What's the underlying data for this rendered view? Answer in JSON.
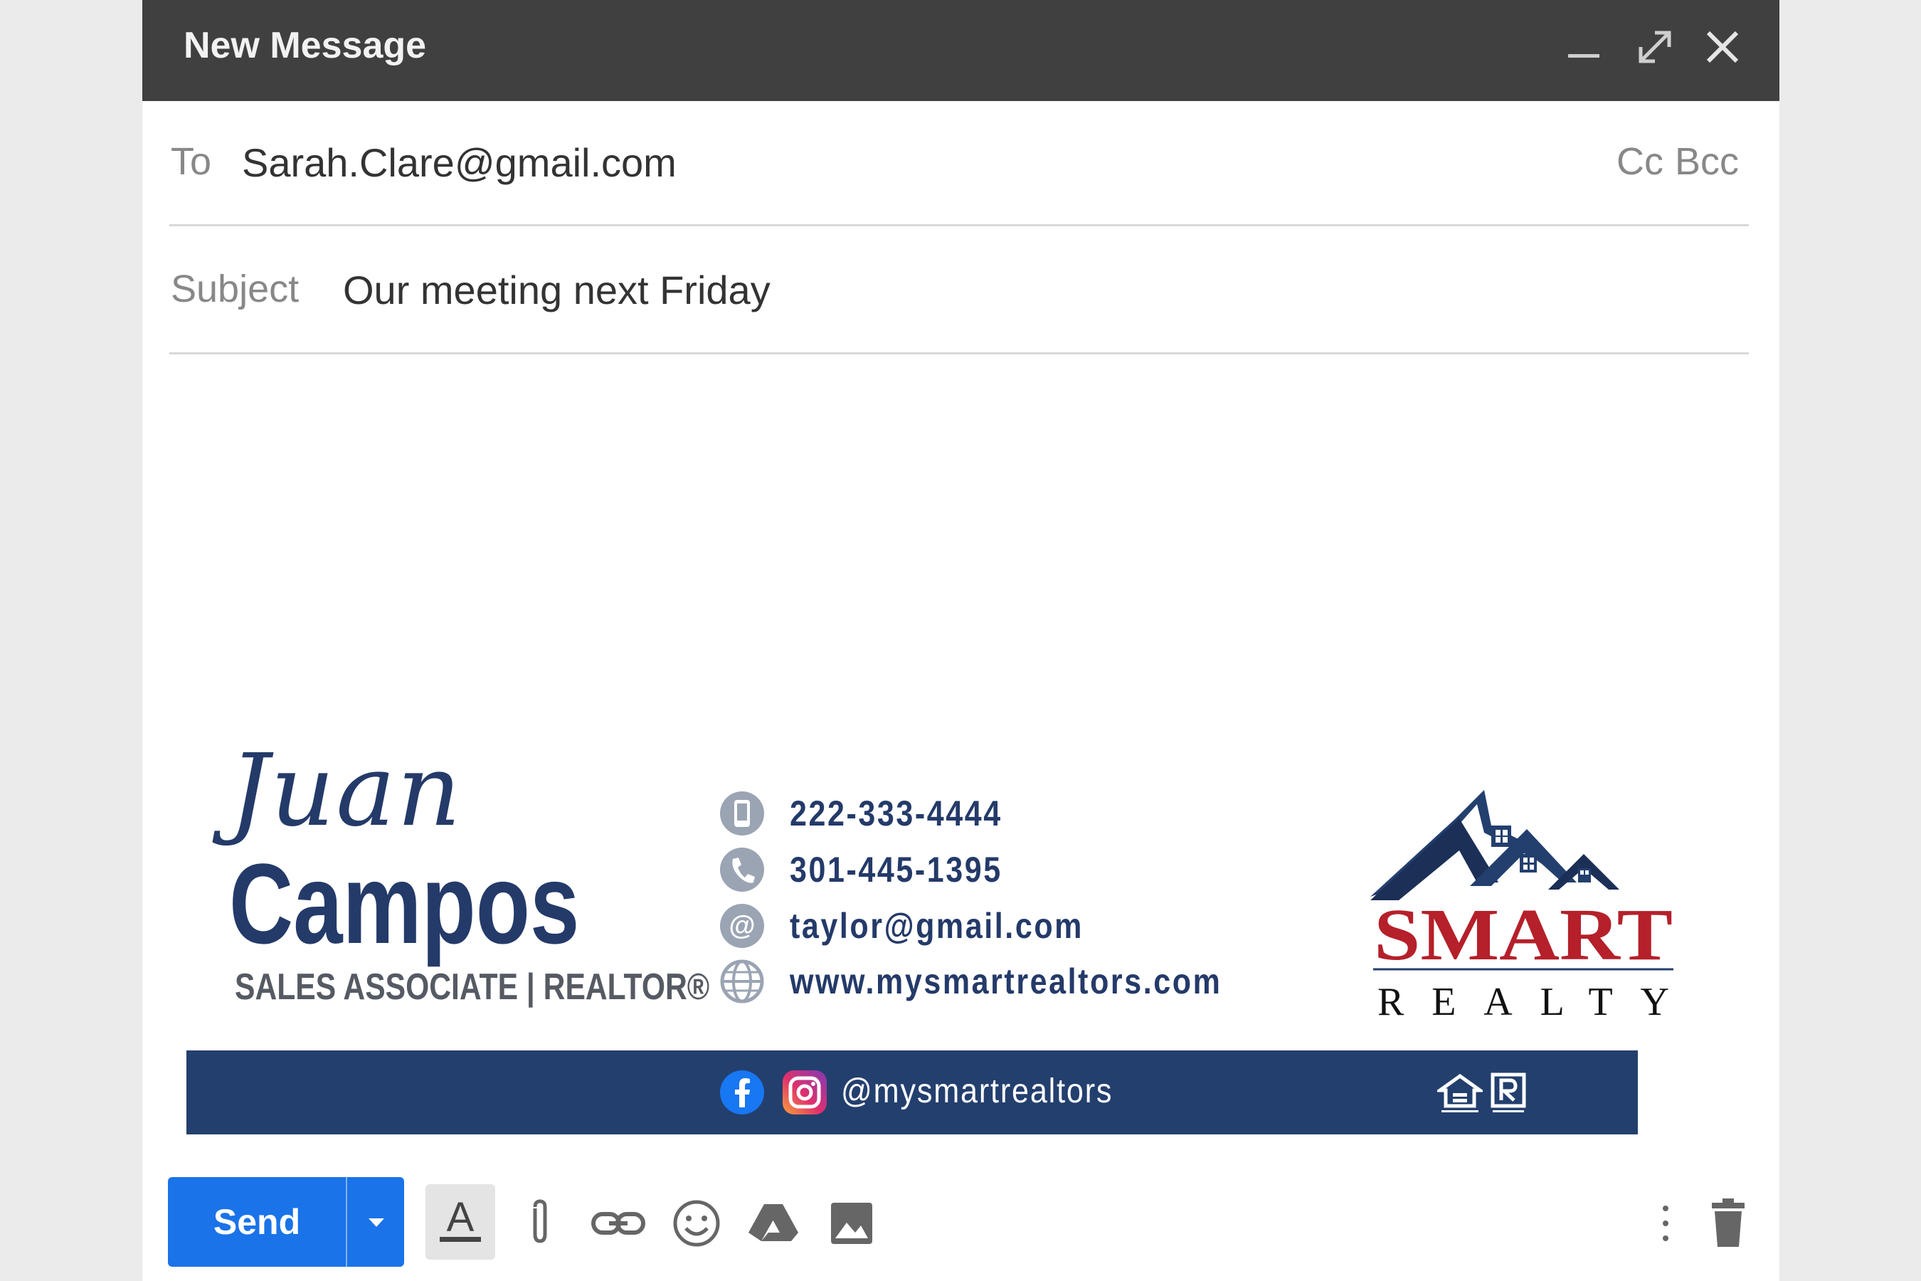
{
  "window": {
    "title": "New Message",
    "controls": {
      "minimize": "minimize-icon",
      "expand": "expand-icon",
      "close": "close-icon"
    }
  },
  "compose": {
    "to_label": "To",
    "to_value": "Sarah.Clare@gmail.com",
    "cc_label": "Cc",
    "bcc_label": "Bcc",
    "subject_label": "Subject",
    "subject_value": "Our meeting next Friday",
    "body_text": ""
  },
  "signature": {
    "first_name": "Juan",
    "last_name": "Campos",
    "role": "SALES ASSOCIATE | REALTOR®",
    "contacts": [
      {
        "icon": "mobile-phone-icon",
        "text": "222-333-4444"
      },
      {
        "icon": "phone-icon",
        "text": "301-445-1395"
      },
      {
        "icon": "at-sign-icon",
        "text": "taylor@gmail.com"
      },
      {
        "icon": "globe-icon",
        "text": "www.mysmartrealtors.com"
      }
    ],
    "logo": {
      "line1": "SMART",
      "line2": "REALTY"
    },
    "social_handle": "@mysmartrealtors",
    "colors": {
      "navy": "#233f6e",
      "red": "#b5202a",
      "gray": "#555a63"
    }
  },
  "toolbar": {
    "send_label": "Send",
    "icons": [
      "formatting-options-icon",
      "attach-file-icon",
      "insert-link-icon",
      "insert-emoji-icon",
      "google-drive-icon",
      "insert-photo-icon",
      "more-options-icon",
      "discard-draft-icon"
    ]
  },
  "colors": {
    "titlebar": "#404040",
    "send_button": "#1a73e8",
    "background": "#ebebeb"
  }
}
